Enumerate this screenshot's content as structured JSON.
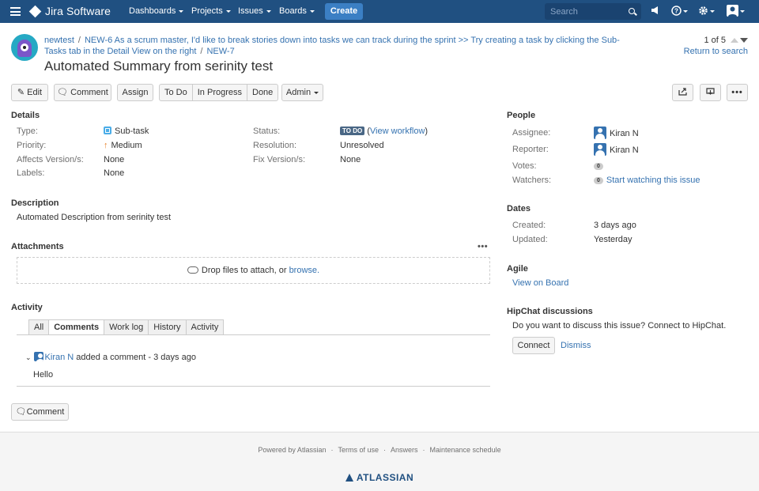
{
  "topnav": {
    "product": "Jira Software",
    "menus": [
      "Dashboards",
      "Projects",
      "Issues",
      "Boards"
    ],
    "create_label": "Create",
    "search_placeholder": "Search"
  },
  "header": {
    "breadcrumb": {
      "project": "newtest",
      "parent": "NEW-6 As a scrum master, I'd like to break stories down into tasks we can track during the sprint >> Try creating a task by clicking the Sub-Tasks tab in the Detail View on the right",
      "issue": "NEW-7"
    },
    "title": "Automated Summary from serinity test",
    "pager": {
      "count": "1 of 5",
      "return_link": "Return to search"
    }
  },
  "toolbar": {
    "edit": "Edit",
    "comment": "Comment",
    "assign": "Assign",
    "transitions": [
      "To Do",
      "In Progress",
      "Done"
    ],
    "admin": "Admin"
  },
  "details": {
    "heading": "Details",
    "type_label": "Type:",
    "type_value": "Sub-task",
    "priority_label": "Priority:",
    "priority_value": "Medium",
    "affects_label": "Affects Version/s:",
    "affects_value": "None",
    "labels_label": "Labels:",
    "labels_value": "None",
    "status_label": "Status:",
    "status_value": "TO DO",
    "status_link": "View workflow",
    "resolution_label": "Resolution:",
    "resolution_value": "Unresolved",
    "fix_label": "Fix Version/s:",
    "fix_value": "None"
  },
  "description": {
    "heading": "Description",
    "text": "Automated Description from serinity test"
  },
  "attachments": {
    "heading": "Attachments",
    "drop_text": "Drop files to attach, or",
    "browse": "browse."
  },
  "activity": {
    "heading": "Activity",
    "tabs": [
      "All",
      "Comments",
      "Work log",
      "History",
      "Activity"
    ],
    "active_tab": "Comments",
    "comment_author": "Kiran N",
    "comment_meta": "added a comment - 3 days ago",
    "comment_body": "Hello",
    "add_comment": "Comment"
  },
  "people": {
    "heading": "People",
    "assignee_label": "Assignee:",
    "assignee": "Kiran N",
    "reporter_label": "Reporter:",
    "reporter": "Kiran N",
    "votes_label": "Votes:",
    "votes": "0",
    "watchers_label": "Watchers:",
    "watchers": "0",
    "watch_link": "Start watching this issue"
  },
  "dates": {
    "heading": "Dates",
    "created_label": "Created:",
    "created": "3 days ago",
    "updated_label": "Updated:",
    "updated": "Yesterday"
  },
  "agile": {
    "heading": "Agile",
    "link": "View on Board"
  },
  "hipchat": {
    "heading": "HipChat discussions",
    "text": "Do you want to discuss this issue? Connect to HipChat.",
    "connect": "Connect",
    "dismiss": "Dismiss"
  },
  "footer": {
    "links": [
      "Powered by Atlassian",
      "Terms of use",
      "Answers",
      "Maintenance schedule"
    ],
    "brand": "ATLASSIAN"
  },
  "colors": {
    "nav": "#205081",
    "link": "#3572b0",
    "create": "#3b7fc4",
    "status": "#4a6785"
  }
}
